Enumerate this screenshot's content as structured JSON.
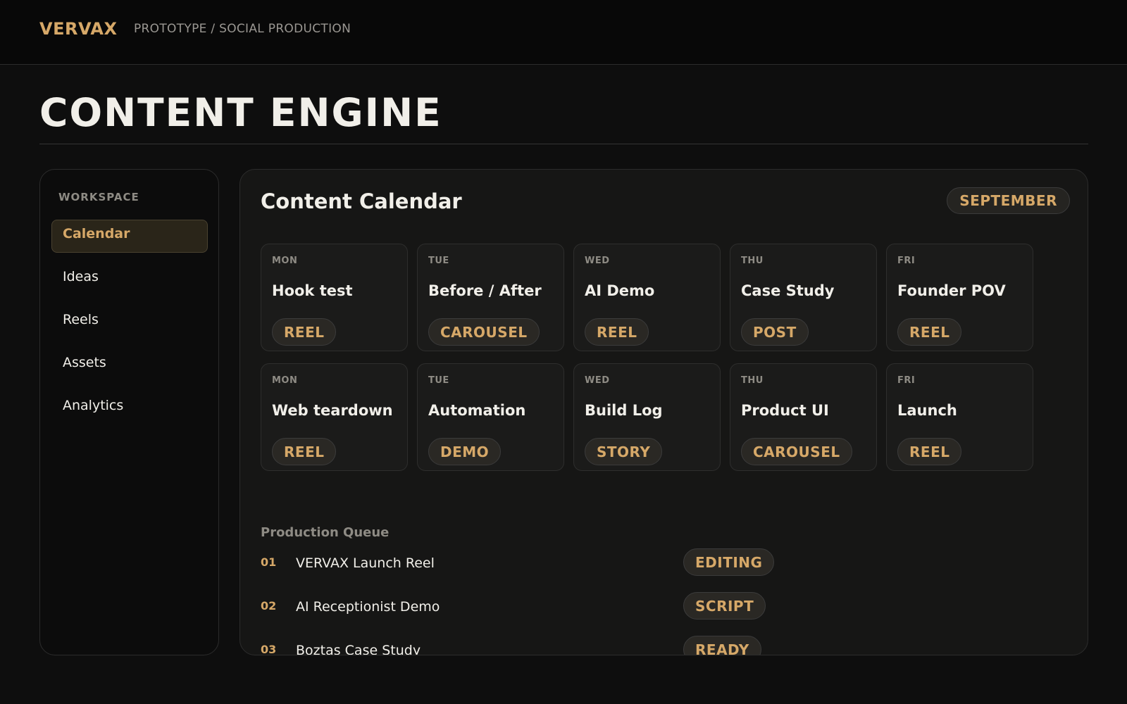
{
  "header": {
    "brand": "VERVAX",
    "breadcrumb": "PROTOTYPE / SOCIAL PRODUCTION"
  },
  "page": {
    "title": "CONTENT ENGINE"
  },
  "sidebar": {
    "section_label": "WORKSPACE",
    "items": [
      {
        "label": "Calendar",
        "active": true
      },
      {
        "label": "Ideas",
        "active": false
      },
      {
        "label": "Reels",
        "active": false
      },
      {
        "label": "Assets",
        "active": false
      },
      {
        "label": "Analytics",
        "active": false
      }
    ]
  },
  "calendar": {
    "title": "Content Calendar",
    "month": "SEPTEMBER",
    "weeks": [
      [
        {
          "day": "MON",
          "title": "Hook test",
          "tag": "REEL"
        },
        {
          "day": "TUE",
          "title": "Before / After",
          "tag": "CAROUSEL"
        },
        {
          "day": "WED",
          "title": "AI Demo",
          "tag": "REEL"
        },
        {
          "day": "THU",
          "title": "Case Study",
          "tag": "POST"
        },
        {
          "day": "FRI",
          "title": "Founder POV",
          "tag": "REEL"
        }
      ],
      [
        {
          "day": "MON",
          "title": "Web teardown",
          "tag": "REEL"
        },
        {
          "day": "TUE",
          "title": "Automation",
          "tag": "DEMO"
        },
        {
          "day": "WED",
          "title": "Build Log",
          "tag": "STORY"
        },
        {
          "day": "THU",
          "title": "Product UI",
          "tag": "CAROUSEL"
        },
        {
          "day": "FRI",
          "title": "Launch",
          "tag": "REEL"
        }
      ]
    ]
  },
  "queue": {
    "title": "Production Queue",
    "items": [
      {
        "num": "01",
        "name": "VERVAX Launch Reel",
        "status": "EDITING"
      },
      {
        "num": "02",
        "name": "AI Receptionist Demo",
        "status": "SCRIPT"
      },
      {
        "num": "03",
        "name": "Boztaş Case Study",
        "status": "READY"
      }
    ]
  },
  "colors": {
    "accent": "#d6a868",
    "background": "#0e0e0e",
    "panel": "#161615",
    "text": "#f1efe9",
    "muted": "#8e8b84"
  }
}
